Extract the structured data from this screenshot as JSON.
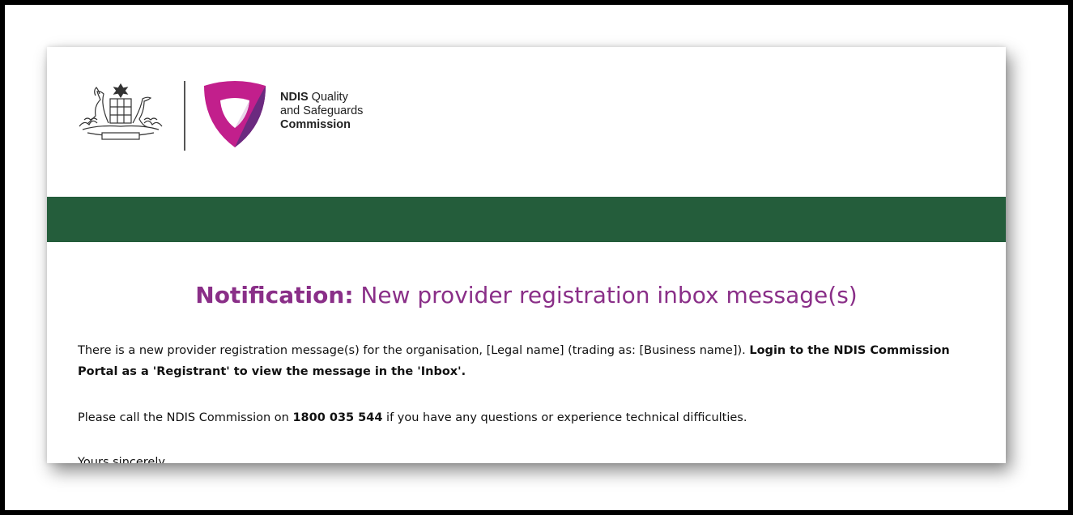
{
  "brand": {
    "line1_bold": "NDIS",
    "line1_rest": " Quality",
    "line2": "and Safeguards",
    "line3": "Commission"
  },
  "colors": {
    "banner_green": "#245d3b",
    "heading_purple": "#8a2f88",
    "shield_magenta": "#c21f8c",
    "shield_purple": "#6b2a7f"
  },
  "notification": {
    "title_label": "Notification:",
    "title_text": " New provider registration inbox message(s)"
  },
  "message": {
    "p1_text": "There is a new provider registration message(s) for the organisation, [Legal name] (trading as: [Business name]). ",
    "p1_bold": "Login to the NDIS Commission Portal as a 'Registrant' to view the message in the 'Inbox'.",
    "p2_pre": "Please call the NDIS Commission on ",
    "p2_phone": "1800 035 544",
    "p2_post": " if you have any questions or experience technical difficulties.",
    "p3_partial": "Yours sincerely,"
  }
}
